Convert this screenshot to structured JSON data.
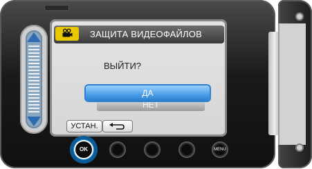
{
  "screen": {
    "title": "ЗАЩИТА ВИДЕОФАЙЛОВ",
    "title_icon": "video-camera-icon",
    "question": "ВЫЙТИ?",
    "options": [
      {
        "label": "ДА",
        "selected": true
      },
      {
        "label": "НЕТ",
        "selected": false
      }
    ]
  },
  "softkeys": {
    "set_label": "УСТАН.",
    "back_icon": "return-arrow-icon"
  },
  "hardware": {
    "ok_label": "OK",
    "menu_label": "MENU"
  },
  "slider": {
    "up_icon": "arrow-up-icon",
    "down_icon": "arrow-down-icon"
  },
  "colors": {
    "accent": "#2c7fcf",
    "title_icon_bg": "#e8c800",
    "ok_ring": "#1e8fd8"
  }
}
